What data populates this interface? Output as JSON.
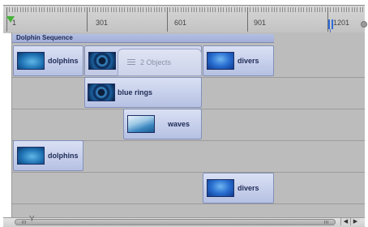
{
  "ruler": {
    "labels": [
      "1",
      "301",
      "601",
      "901",
      "1201"
    ]
  },
  "sequence": {
    "title": "Dolphin Sequence"
  },
  "clips": {
    "dolphins_1": {
      "label": "dolphins",
      "thumb": "dolphins-thumbnail"
    },
    "blue_rings_top": {
      "thumb": "blue-rings-thumbnail"
    },
    "group": {
      "label": "2 Objects",
      "icon": "stack-icon"
    },
    "divers_1": {
      "label": "divers",
      "thumb": "divers-thumbnail"
    },
    "blue_rings": {
      "label": "blue rings",
      "thumb": "blue-rings-thumbnail"
    },
    "waves": {
      "label": "waves",
      "thumb": "waves-thumbnail"
    },
    "dolphins_2": {
      "label": "dolphins",
      "thumb": "dolphins-thumbnail"
    },
    "divers_2": {
      "label": "divers",
      "thumb": "divers-thumbnail"
    }
  },
  "scrollbar": {
    "left_arrow": "◀",
    "right_arrow": "▶",
    "playhead_glyph": "Y"
  },
  "colors": {
    "clip_fill": "#c5cdea",
    "track_bg": "#bcbcbc",
    "in_marker": "#46b23a",
    "out_marker": "#2f6bd6"
  }
}
